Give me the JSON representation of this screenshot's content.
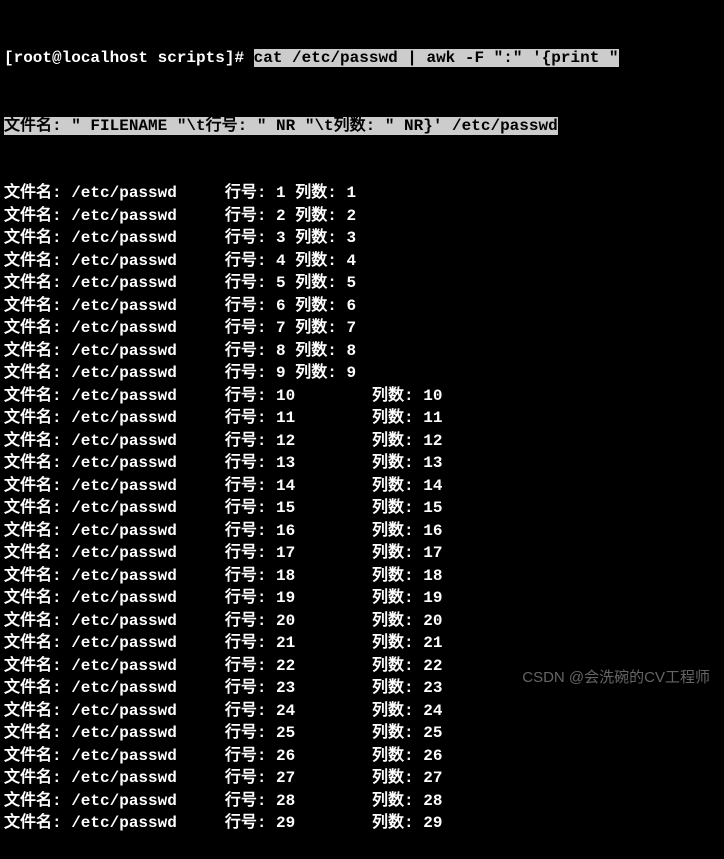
{
  "prompt": {
    "prefix": "[root@localhost scripts]# ",
    "command_line1": "cat /etc/passwd | awk -F \":\" '{print \"",
    "command_line2": "文件名: \" FILENAME \"\\t行号: \" NR \"\\t列数: \" NR}' /etc/passwd"
  },
  "labels": {
    "filename": "文件名:",
    "lineno": "行号:",
    "colcount": "列数:"
  },
  "filename_value": "/etc/passwd",
  "rows": [
    {
      "n": 1
    },
    {
      "n": 2
    },
    {
      "n": 3
    },
    {
      "n": 4
    },
    {
      "n": 5
    },
    {
      "n": 6
    },
    {
      "n": 7
    },
    {
      "n": 8
    },
    {
      "n": 9
    },
    {
      "n": 10
    },
    {
      "n": 11
    },
    {
      "n": 12
    },
    {
      "n": 13
    },
    {
      "n": 14
    },
    {
      "n": 15
    },
    {
      "n": 16
    },
    {
      "n": 17
    },
    {
      "n": 18
    },
    {
      "n": 19
    },
    {
      "n": 20
    },
    {
      "n": 21
    },
    {
      "n": 22
    },
    {
      "n": 23
    },
    {
      "n": 24
    },
    {
      "n": 25
    },
    {
      "n": 26
    },
    {
      "n": 27
    },
    {
      "n": 28
    },
    {
      "n": 29
    }
  ],
  "watermark": "CSDN @会洗碗的CV工程师"
}
